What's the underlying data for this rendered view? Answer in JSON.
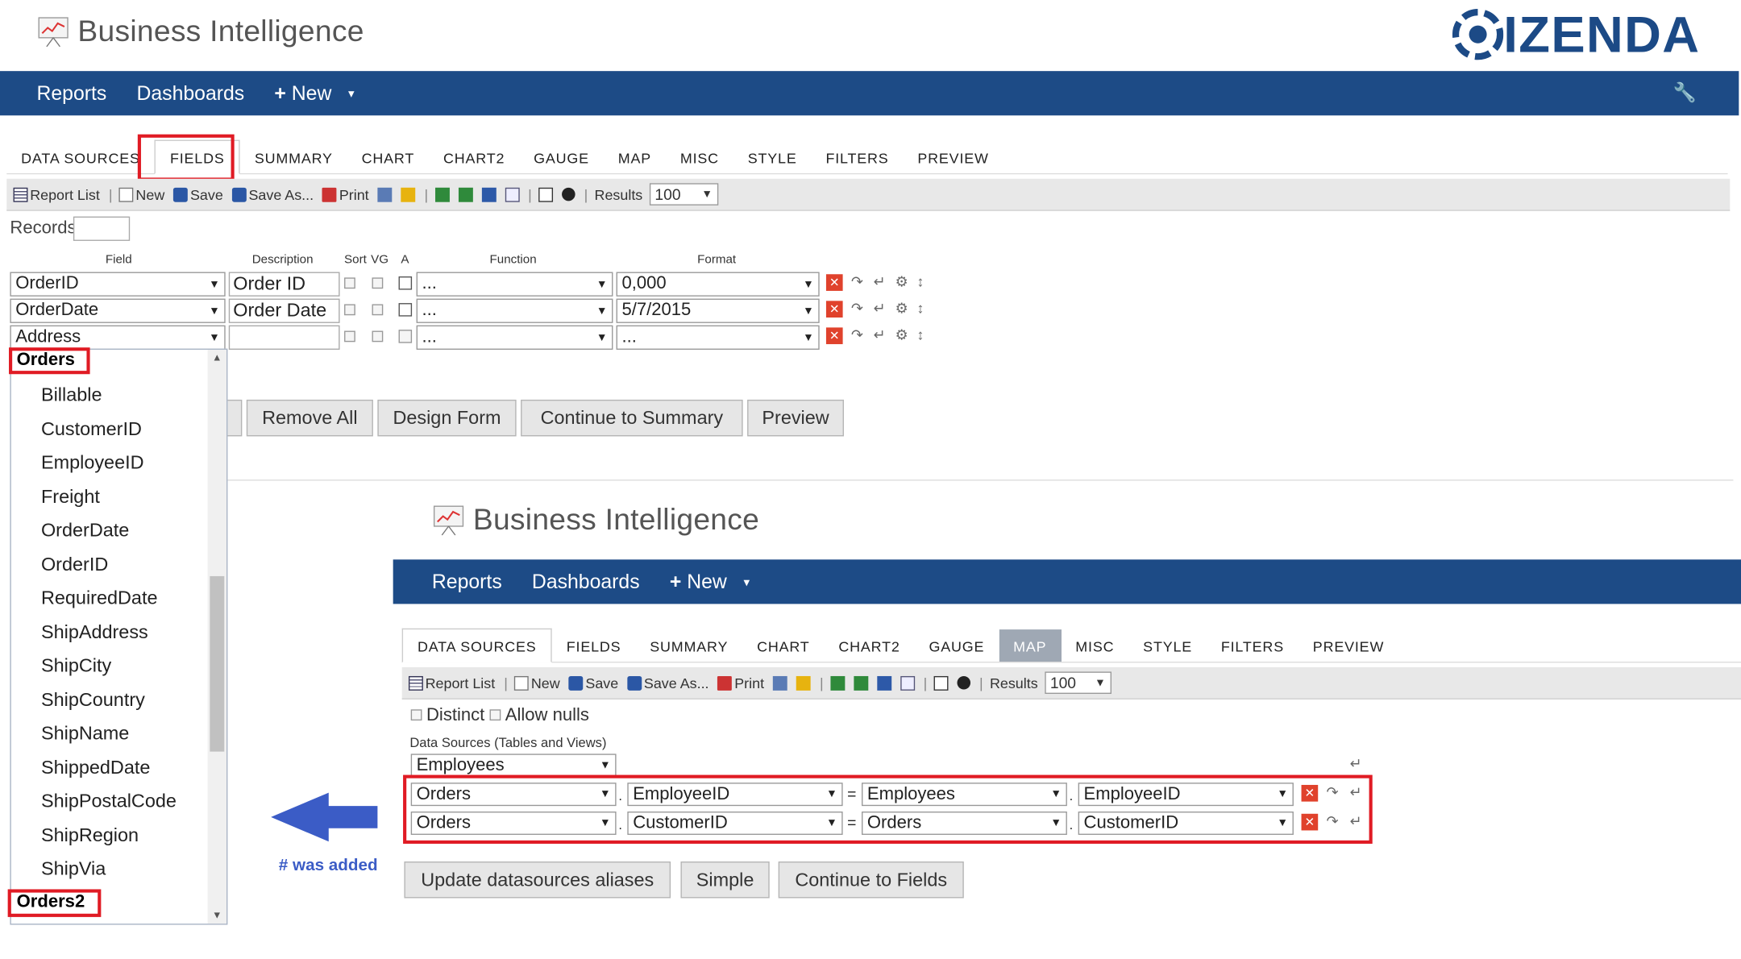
{
  "top": {
    "bi_title": "Business Intelligence",
    "brand": "IZENDA",
    "nav": {
      "reports": "Reports",
      "dashboards": "Dashboards",
      "new": "New"
    }
  },
  "tabs": [
    "DATA SOURCES",
    "FIELDS",
    "SUMMARY",
    "CHART",
    "CHART2",
    "GAUGE",
    "MAP",
    "MISC",
    "STYLE",
    "FILTERS",
    "PREVIEW"
  ],
  "toolbar": {
    "report_list": "Report List",
    "new": "New",
    "save": "Save",
    "save_as": "Save As...",
    "print": "Print",
    "results_label": "Results",
    "results_value": "100"
  },
  "fields_page": {
    "records_label": "Records",
    "headers": {
      "field": "Field",
      "description": "Description",
      "sort": "Sort",
      "vg": "VG",
      "a": "A",
      "function": "Function",
      "format": "Format"
    },
    "rows": [
      {
        "field": "OrderID",
        "description": "Order ID",
        "function": "...",
        "format": "0,000"
      },
      {
        "field": "OrderDate",
        "description": "Order Date",
        "function": "...",
        "format": "5/7/2015"
      },
      {
        "field": "Address",
        "description": "",
        "function": "...",
        "format": "..."
      }
    ],
    "buttons": {
      "remove_all": "Remove All",
      "design_form": "Design Form",
      "continue_summary": "Continue to Summary",
      "preview": "Preview"
    },
    "dropdown": {
      "group1": "Orders",
      "items": [
        "Billable",
        "CustomerID",
        "EmployeeID",
        "Freight",
        "OrderDate",
        "OrderID",
        "RequiredDate",
        "ShipAddress",
        "ShipCity",
        "ShipCountry",
        "ShipName",
        "ShippedDate",
        "ShipPostalCode",
        "ShipRegion",
        "ShipVia"
      ],
      "group2": "Orders2"
    }
  },
  "annotation": {
    "note": "# was added"
  },
  "ds_page": {
    "distinct": "Distinct",
    "allow_nulls": "Allow nulls",
    "section_label": "Data Sources (Tables and Views)",
    "main_table": "Employees",
    "joins": [
      {
        "left_table": "Orders",
        "left_field": "EmployeeID",
        "right_table": "Employees",
        "right_field": "EmployeeID"
      },
      {
        "left_table": "Orders",
        "left_field": "CustomerID",
        "right_table": "Orders",
        "right_field": "CustomerID"
      }
    ],
    "buttons": {
      "update_aliases": "Update datasources aliases",
      "simple": "Simple",
      "continue_fields": "Continue to Fields"
    }
  },
  "colors": {
    "nav_bg": "#1d4b86",
    "highlight": "#e01b24",
    "arrow": "#3b5cc6",
    "brand": "#1c4a86"
  }
}
